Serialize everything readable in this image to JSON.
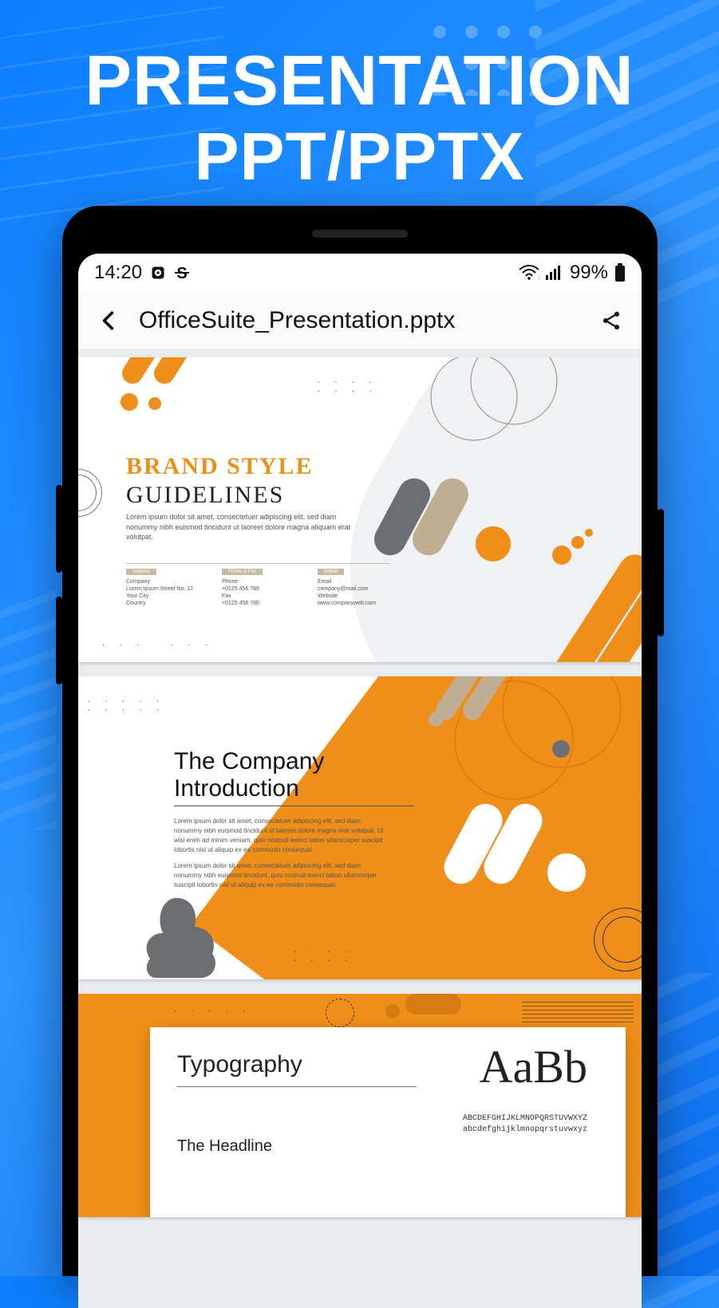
{
  "promo": {
    "line1": "PRESENTATION",
    "line2": "PPT/PPTX"
  },
  "status": {
    "time": "14:20",
    "battery": "99%"
  },
  "appbar": {
    "title": "OfficeSuite_Presentation.pptx"
  },
  "slide1": {
    "title1": "BRAND STYLE",
    "title2": "GUIDELINES",
    "body": "Lorem ipsum dolor sit amet, consectetuer adipiscing elit, sed diam nonummy nibh euismod tincidunt ut laoreet dolore magna aliquam erat volutpat.",
    "cols": [
      {
        "tag": "Address",
        "lines": [
          "Company",
          "Lorem Ipsum Street No. 12",
          "Your City",
          "Country"
        ]
      },
      {
        "tag": "Phone & Fax",
        "lines": [
          "Phone",
          "+0125 456 789",
          "Fax",
          "+0125 456 780"
        ]
      },
      {
        "tag": "Online",
        "lines": [
          "Email",
          "company@mail.com",
          "Website",
          "www.companyweb.com"
        ]
      }
    ]
  },
  "slide2": {
    "title_l1": "The Company",
    "title_l2": "Introduction",
    "body1": "Lorem ipsum dolor sit amet, consectetuer adipiscing elit, sed diam nonummy nibh euismod tincidunt ut laoreet dolore magna erat volutpat. Ut wisi enim ad minim veniam, quis nostrud exerci tation ullamcorper suscipit lobortis nisl ut aliquip ex ea commodo consequat.",
    "body2": "Lorem ipsum dolor sit amet, consectetuer adipiscing elit, sed diam nonummy nibh euismod tincidunt, quis nostrud exerci tation ullamcorper suscipit lobortis nisl ut aliquip ex ea commodo consequat."
  },
  "slide3": {
    "title": "Typography",
    "sample": "AaBb",
    "alpha_upper": "ABCDEFGHIJKLMNOPQRSTUVWXYZ",
    "alpha_lower": "abcdefghijklmnopqrstuvwxyz",
    "headline": "The Headline"
  }
}
